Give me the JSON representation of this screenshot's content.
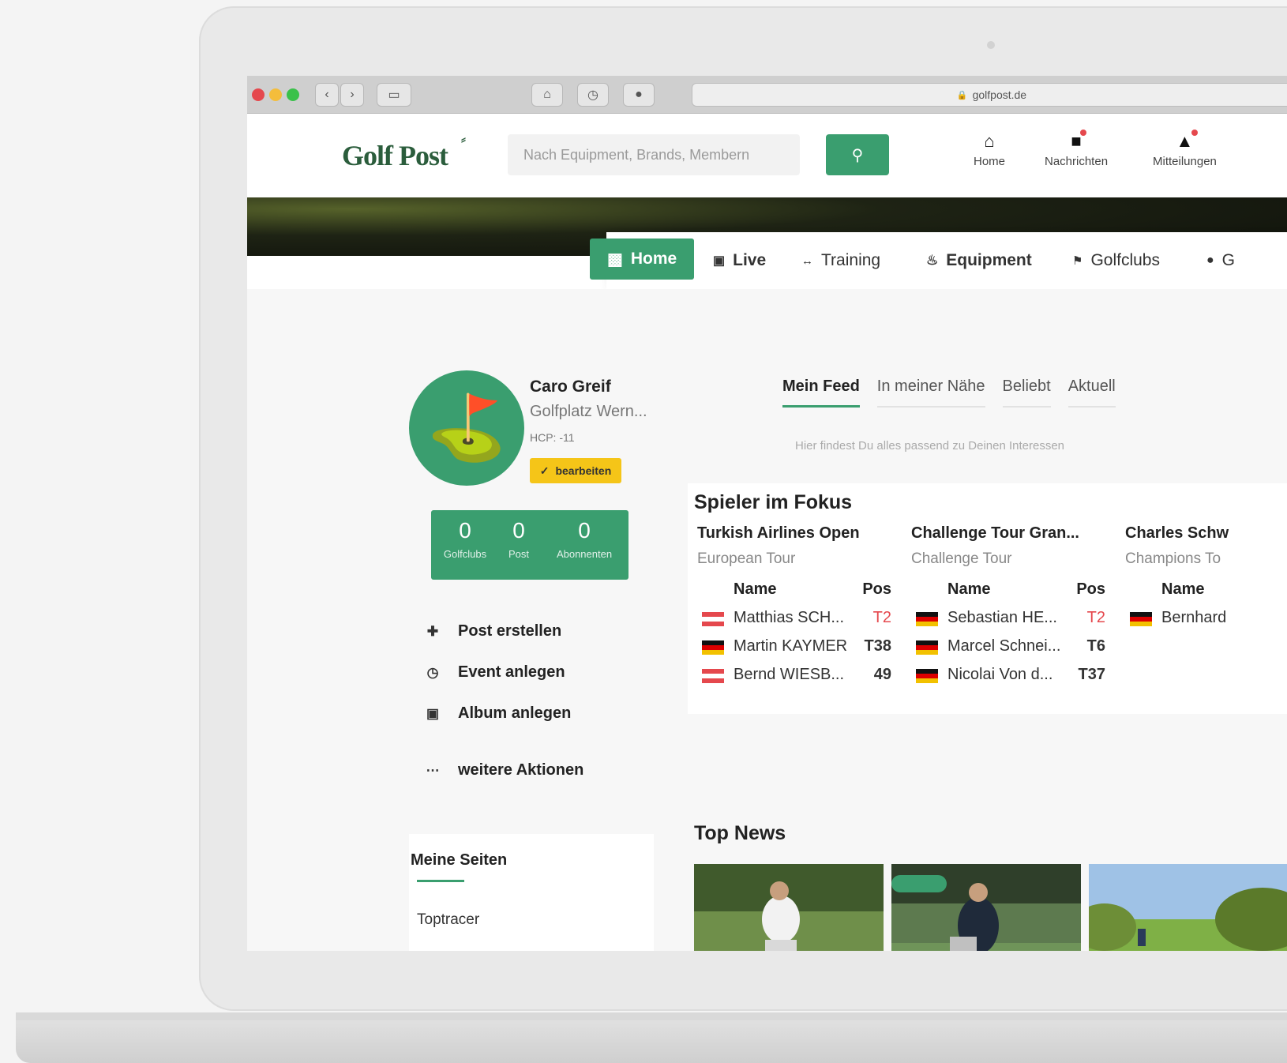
{
  "browser": {
    "url": "golfpost.de"
  },
  "header": {
    "logo": "Golf Post",
    "search_placeholder": "Nach Equipment, Brands, Membern",
    "nav": [
      {
        "label": "Home",
        "icon": "home-icon"
      },
      {
        "label": "Nachrichten",
        "icon": "message-icon"
      },
      {
        "label": "Mitteilungen",
        "icon": "bell-icon"
      }
    ]
  },
  "mainnav": {
    "items": [
      {
        "label": "Home",
        "icon": "home-icon"
      },
      {
        "label": "Live",
        "icon": "tv-icon"
      },
      {
        "label": "Training",
        "icon": "arrows-icon"
      },
      {
        "label": "Equipment",
        "icon": "golf-bag-icon"
      },
      {
        "label": "Golfclubs",
        "icon": "flag-icon"
      },
      {
        "label": "G",
        "icon": "circle-icon"
      }
    ]
  },
  "profile": {
    "name": "Caro Greif",
    "club": "Golfplatz Wern...",
    "hcp": "HCP: -11",
    "edit_label": "bearbeiten",
    "stats": [
      {
        "value": "0",
        "label": "Golfclubs"
      },
      {
        "value": "0",
        "label": "Post"
      },
      {
        "value": "0",
        "label": "Abonnenten"
      }
    ]
  },
  "actions": [
    {
      "label": "Post erstellen",
      "icon": "plus-circle-icon"
    },
    {
      "label": "Event anlegen",
      "icon": "alarm-clock-icon"
    },
    {
      "label": "Album anlegen",
      "icon": "album-icon"
    },
    {
      "label": "weitere Aktionen",
      "icon": "more-icon"
    }
  ],
  "meine_seiten": {
    "title": "Meine Seiten",
    "first_item": "Toptracer"
  },
  "feed": {
    "tabs": [
      "Mein Feed",
      "In meiner Nähe",
      "Beliebt",
      "Aktuell"
    ],
    "hint": "Hier findest Du alles passend zu Deinen Interessen"
  },
  "spieler_im_fokus": {
    "title": "Spieler im Fokus",
    "col_name": "Name",
    "col_pos": "Pos",
    "tours": [
      {
        "name": "Turkish Airlines Open",
        "tour": "European Tour",
        "players": [
          {
            "flag": "at",
            "name": "Matthias SCH...",
            "pos": "T2",
            "highlight": true
          },
          {
            "flag": "de",
            "name": "Martin KAYMER",
            "pos": "T38",
            "highlight": false
          },
          {
            "flag": "at",
            "name": "Bernd WIESB...",
            "pos": "49",
            "highlight": false
          }
        ]
      },
      {
        "name": "Challenge Tour Gran...",
        "tour": "Challenge Tour",
        "players": [
          {
            "flag": "de",
            "name": "Sebastian HE...",
            "pos": "T2",
            "highlight": true
          },
          {
            "flag": "de",
            "name": "Marcel Schnei...",
            "pos": "T6",
            "highlight": false
          },
          {
            "flag": "de",
            "name": "Nicolai Von d...",
            "pos": "T37",
            "highlight": false
          }
        ]
      },
      {
        "name": "Charles Schw",
        "tour": "Champions To",
        "players": [
          {
            "flag": "de",
            "name": "Bernhard",
            "pos": "",
            "highlight": false
          }
        ]
      }
    ]
  },
  "top_news": {
    "title": "Top News"
  },
  "colors": {
    "accent": "#3a9e6f",
    "edit": "#f5c518",
    "highlight": "#e5484d"
  }
}
